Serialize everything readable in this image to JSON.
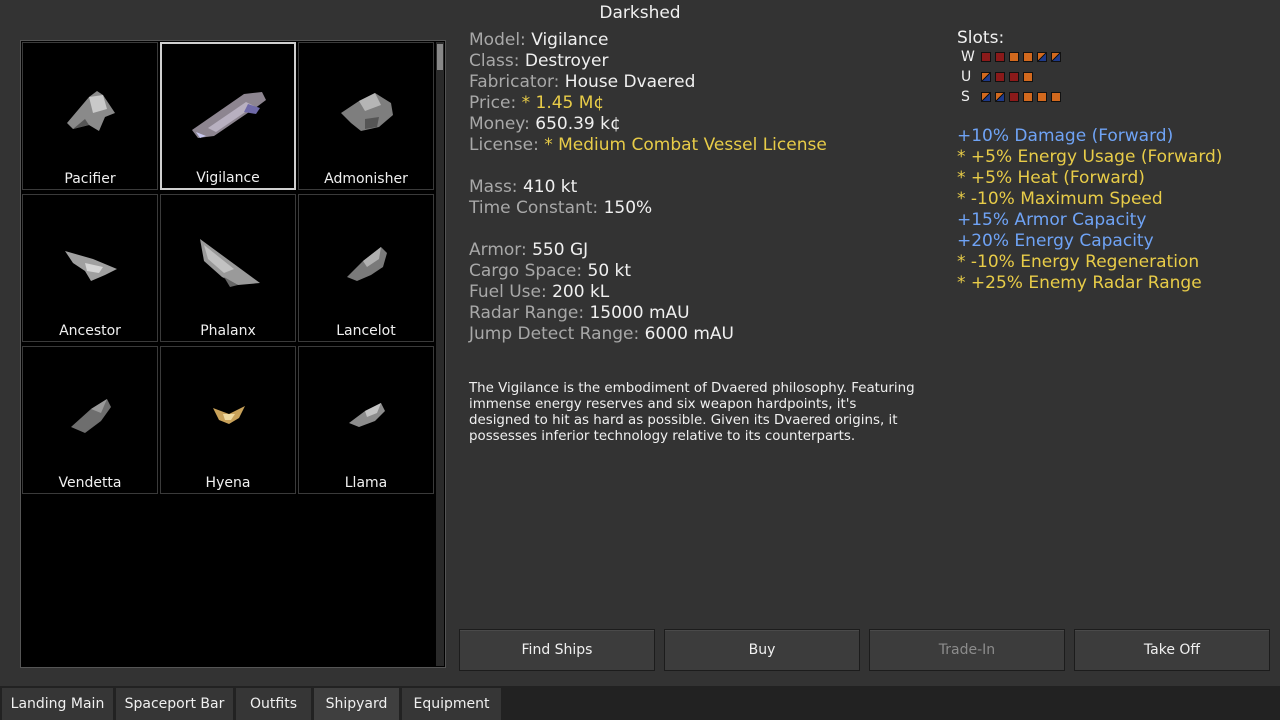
{
  "window": {
    "title": "Darkshed"
  },
  "ships": [
    {
      "name": "Pacifier",
      "icon": "ship-pacifier-icon"
    },
    {
      "name": "Vigilance",
      "icon": "ship-vigilance-icon",
      "selected": true
    },
    {
      "name": "Admonisher",
      "icon": "ship-admonisher-icon"
    },
    {
      "name": "Ancestor",
      "icon": "ship-ancestor-icon"
    },
    {
      "name": "Phalanx",
      "icon": "ship-phalanx-icon"
    },
    {
      "name": "Lancelot",
      "icon": "ship-lancelot-icon"
    },
    {
      "name": "Vendetta",
      "icon": "ship-vendetta-icon"
    },
    {
      "name": "Hyena",
      "icon": "ship-hyena-icon"
    },
    {
      "name": "Llama",
      "icon": "ship-llama-icon"
    }
  ],
  "info": {
    "model_label": "Model:",
    "model": "Vigilance",
    "class_label": "Class:",
    "class": "Destroyer",
    "fabricator_label": "Fabricator:",
    "fabricator": "House Dvaered",
    "price_label": "Price:",
    "price": "* 1.45 M¢",
    "money_label": "Money:",
    "money": "650.39 k¢",
    "license_label": "License:",
    "license": "* Medium Combat Vessel License",
    "mass_label": "Mass:",
    "mass": "410 kt",
    "time_constant_label": "Time Constant:",
    "time_constant": "150%",
    "armor_label": "Armor:",
    "armor": "550 GJ",
    "cargo_label": "Cargo Space:",
    "cargo": "50 kt",
    "fuel_label": "Fuel Use:",
    "fuel": "200 kL",
    "radar_label": "Radar Range:",
    "radar": "15000 mAU",
    "jump_label": "Jump Detect Range:",
    "jump": "6000 mAU"
  },
  "description": "The Vigilance is the embodiment of Dvaered philosophy. Featuring immense energy reserves and six weapon hardpoints, it's designed to hit as hard as possible. Given its Dvaered origins, it possesses inferior technology relative to its counterparts.",
  "slots": {
    "title": "Slots:",
    "rows": [
      {
        "type": "W",
        "boxes": [
          "#8b1a1a",
          "#8b1a1a",
          "#d2691e",
          "#d2691e",
          "#d2691e/#1e3a8a",
          "#d2691e/#1e3a8a"
        ]
      },
      {
        "type": "U",
        "boxes": [
          "#d2691e/#1e3a8a",
          "#8b1a1a",
          "#8b1a1a",
          "#d2691e"
        ]
      },
      {
        "type": "S",
        "boxes": [
          "#d2691e/#1e3a8a",
          "#d2691e/#1e3a8a",
          "#8b1a1a",
          "#d2691e",
          "#d2691e",
          "#d2691e"
        ]
      }
    ]
  },
  "stats": [
    {
      "text": "+10% Damage (Forward)",
      "kind": "pos"
    },
    {
      "text": "* +5% Energy Usage (Forward)",
      "kind": "neg"
    },
    {
      "text": "* +5% Heat (Forward)",
      "kind": "neg"
    },
    {
      "text": "* -10% Maximum Speed",
      "kind": "neg"
    },
    {
      "text": "+15% Armor Capacity",
      "kind": "pos"
    },
    {
      "text": "+20% Energy Capacity",
      "kind": "pos"
    },
    {
      "text": "* -10% Energy Regeneration",
      "kind": "neg"
    },
    {
      "text": "* +25% Enemy Radar Range",
      "kind": "neg"
    }
  ],
  "buttons": {
    "find_ships": "Find Ships",
    "buy": "Buy",
    "trade_in": "Trade-In",
    "take_off": "Take Off"
  },
  "tabs": [
    {
      "label": "Landing Main"
    },
    {
      "label": "Spaceport Bar"
    },
    {
      "label": "Outfits"
    },
    {
      "label": "Shipyard",
      "active": true
    },
    {
      "label": "Equipment"
    }
  ],
  "colors": {
    "positive": "#6fa3f5",
    "warning": "#e8cc48"
  }
}
